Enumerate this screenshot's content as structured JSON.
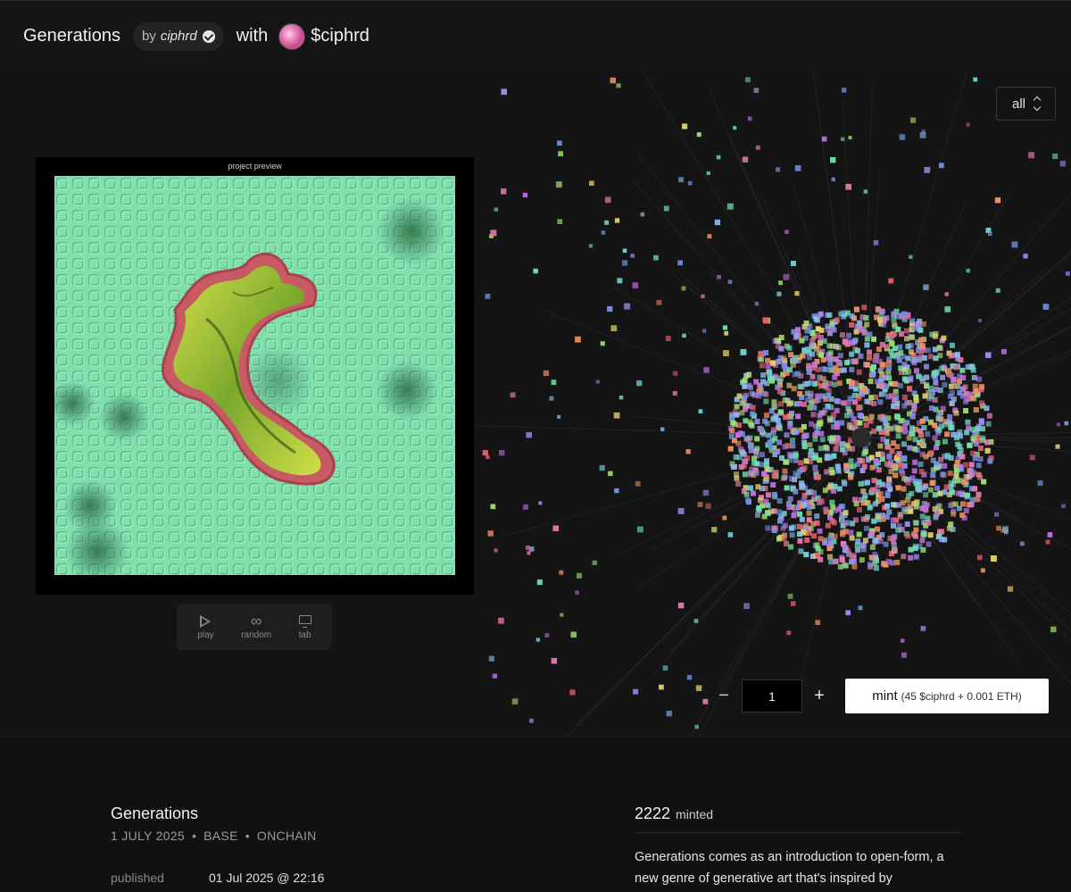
{
  "header": {
    "title": "Generations",
    "by_prefix": "by",
    "author": "ciphrd",
    "with_label": "with",
    "token": "$ciphrd"
  },
  "canvas": {
    "filter_value": "all"
  },
  "preview": {
    "label": "project preview"
  },
  "controls": [
    {
      "label": "play",
      "icon": "play-icon"
    },
    {
      "label": "random",
      "icon": "infinity-icon"
    },
    {
      "label": "tab",
      "icon": "monitor-icon"
    }
  ],
  "mint": {
    "minus": "−",
    "quantity": "1",
    "plus": "+",
    "button_label": "mint",
    "price": "(45 $ciphrd + 0.001 ETH)"
  },
  "project": {
    "title": "Generations",
    "date": "1 JULY 2025",
    "chain": "BASE",
    "storage": "ONCHAIN",
    "separator": "•",
    "published_label": "published",
    "published_value": "01 Jul 2025 @ 22:16",
    "minted_count": "2222",
    "minted_label": "minted",
    "description": "Generations comes as an introduction to open-form, a new genre of generative art that's inspired by"
  },
  "colors": {
    "accent_green": "#7fe3b0",
    "blob_red": "#c85a64",
    "blob_yellow": "#c8d840"
  }
}
